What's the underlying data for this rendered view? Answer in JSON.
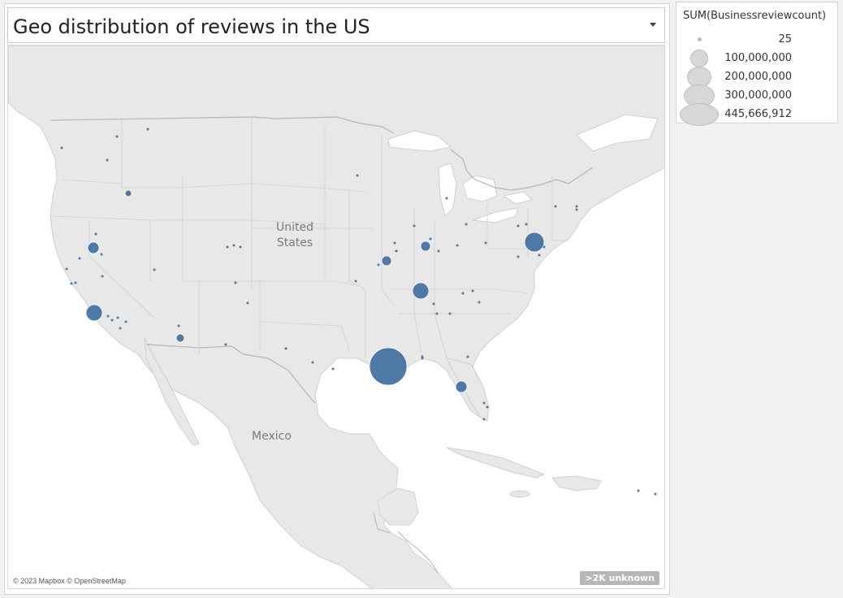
{
  "title": "Geo distribution of reviews in the US",
  "map": {
    "labels": {
      "united_states": "United\nStates",
      "mexico": "Mexico"
    },
    "attribution": "© 2023 Mapbox © OpenStreetMap",
    "unknown_badge": ">2K unknown",
    "mark_color": "#4e79a7"
  },
  "legend": {
    "title": "SUM(Businessreviewcount)",
    "entries": [
      "25",
      "100,000,000",
      "200,000,000",
      "300,000,000",
      "445,666,912"
    ]
  },
  "colors": {
    "land": "#e6e6e6",
    "water": "#ffffff",
    "border": "#c8c8c8",
    "marks": "#4e79a7"
  }
}
